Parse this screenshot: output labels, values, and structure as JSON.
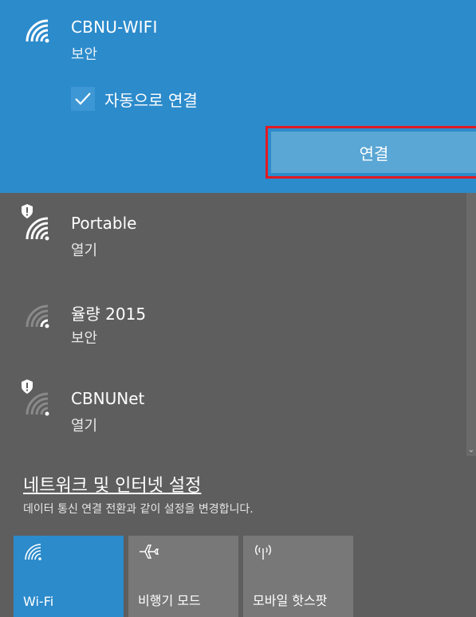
{
  "selected_network": {
    "name": "CBNU-WIFI",
    "security": "보안",
    "auto_connect_label": "자동으로 연결",
    "auto_connect_checked": true,
    "connect_button": "연결",
    "accent_color": "#2c8bcb"
  },
  "networks": [
    {
      "name": "Portable",
      "security": "열기",
      "icon": "wifi-secured-warning-icon"
    },
    {
      "name": "율량 2015",
      "security": "보안",
      "icon": "wifi-weak-icon"
    },
    {
      "name": "CBNUNet",
      "security": "열기",
      "icon": "wifi-secured-warning-icon"
    }
  ],
  "settings": {
    "link_label": "네트워크 및 인터넷 설정",
    "description": "데이터 통신 연결 전환과 같이 설정을 변경합니다."
  },
  "quick_actions": [
    {
      "label": "Wi-Fi",
      "icon": "wifi-icon",
      "active": true
    },
    {
      "label": "비행기 모드",
      "icon": "airplane-icon",
      "active": false
    },
    {
      "label": "모바일 핫스팟",
      "icon": "hotspot-icon",
      "active": false
    }
  ]
}
